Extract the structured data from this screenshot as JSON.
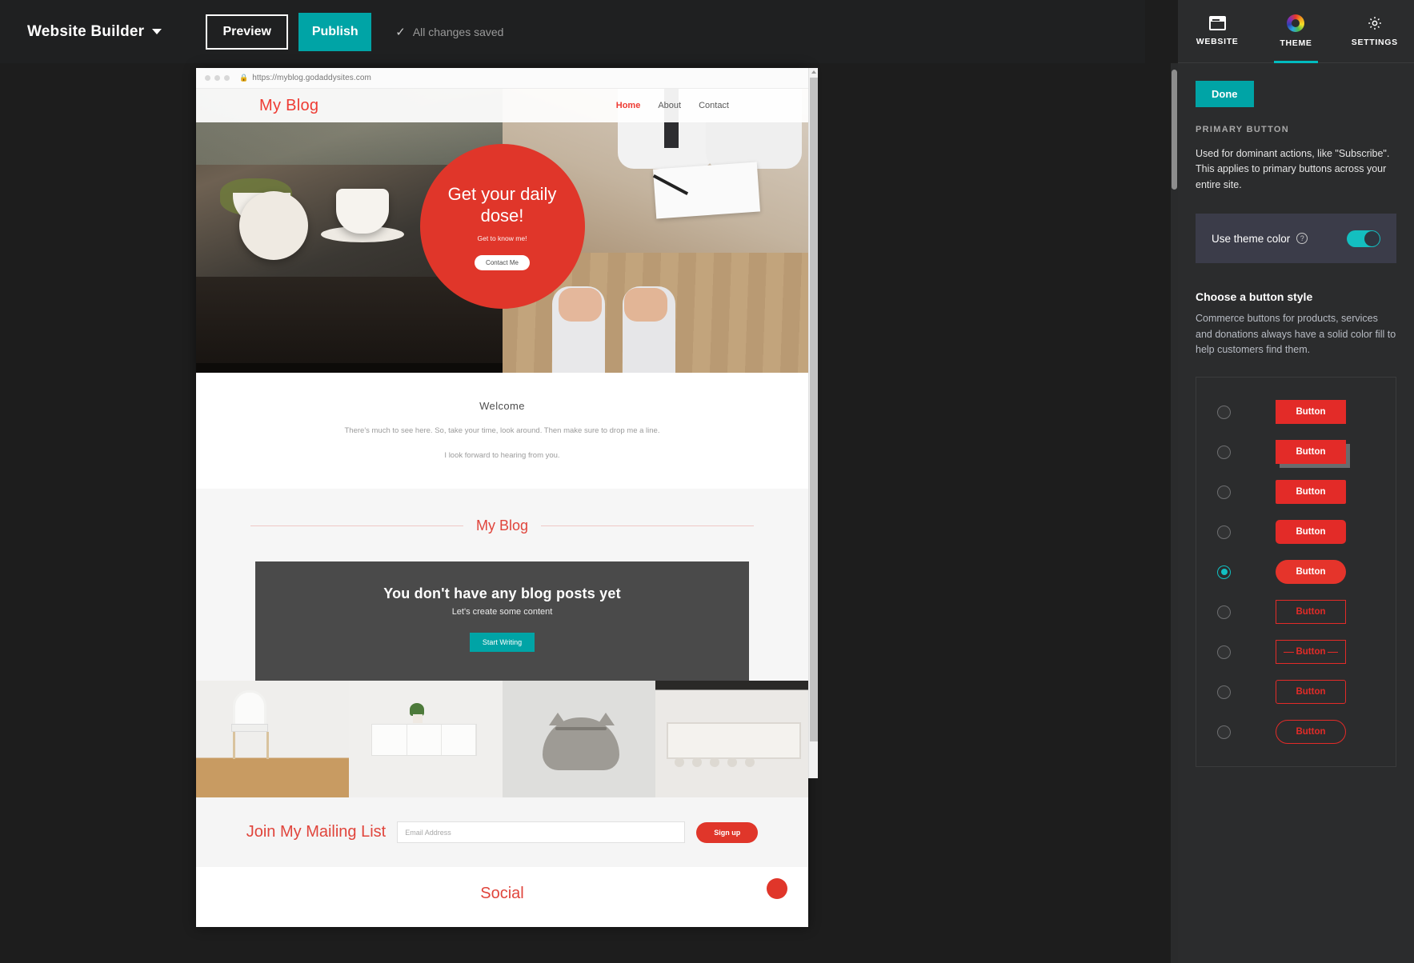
{
  "topbar": {
    "brand": "Website Builder",
    "chevron_icon": "chevron-down-icon",
    "preview_label": "Preview",
    "publish_label": "Publish",
    "saved_label": "All changes saved",
    "check_icon": "check-icon",
    "publish_color": "#00a4a6"
  },
  "preview": {
    "url": "https://myblog.godaddysites.com",
    "lock_icon": "lock-icon",
    "site_title": "My Blog",
    "nav": [
      {
        "label": "Home",
        "active": true
      },
      {
        "label": "About",
        "active": false
      },
      {
        "label": "Contact",
        "active": false
      }
    ],
    "hero": {
      "headline": "Get your daily dose!",
      "subtext": "Get to know me!",
      "button": "Contact Me",
      "circle_color": "#e0362a"
    },
    "welcome": {
      "heading": "Welcome",
      "line1": "There's much to see here. So, take your time, look around. Then make sure to drop me a line.",
      "line2": "I look forward to hearing from you."
    },
    "blog": {
      "section_title": "My Blog",
      "empty_heading": "You don't have any blog posts yet",
      "empty_sub": "Let's create some content",
      "empty_button": "Start Writing"
    },
    "mailing": {
      "heading": "Join My Mailing List",
      "placeholder": "Email Address",
      "value": "",
      "signup_label": "Sign up"
    },
    "social": {
      "heading": "Social"
    }
  },
  "panel": {
    "tabs": [
      {
        "label": "WEBSITE",
        "icon": "website-icon",
        "active": false
      },
      {
        "label": "THEME",
        "icon": "color-wheel-icon",
        "active": true
      },
      {
        "label": "SETTINGS",
        "icon": "gear-icon",
        "active": false
      }
    ],
    "done_label": "Done",
    "section_title": "PRIMARY BUTTON",
    "section_desc": "Used for dominant actions, like \"Subscribe\". This applies to primary buttons across your entire site.",
    "theme_color_label": "Use theme color",
    "help_icon": "question-mark-icon",
    "toggle_on": true,
    "toggle_color": "#14bfc0",
    "style_title": "Choose a button style",
    "style_desc": "Commerce buttons for products, services and donations always have a solid color fill to help customers find them.",
    "button_styles": [
      {
        "label": "Button",
        "variant": "fill-square",
        "selected": false
      },
      {
        "label": "Button",
        "variant": "fill-shadow",
        "selected": false
      },
      {
        "label": "Button",
        "variant": "fill-r2",
        "selected": false
      },
      {
        "label": "Button",
        "variant": "fill-r5",
        "selected": false
      },
      {
        "label": "Button",
        "variant": "fill-pill",
        "selected": true
      },
      {
        "label": "Button",
        "variant": "outline-square",
        "selected": false
      },
      {
        "label": "Button",
        "variant": "outline-dash",
        "selected": false
      },
      {
        "label": "Button",
        "variant": "outline-r3",
        "selected": false
      },
      {
        "label": "Button",
        "variant": "outline-pill",
        "selected": false
      }
    ],
    "accent_color": "#e32b28",
    "teal": "#00bcbf"
  }
}
